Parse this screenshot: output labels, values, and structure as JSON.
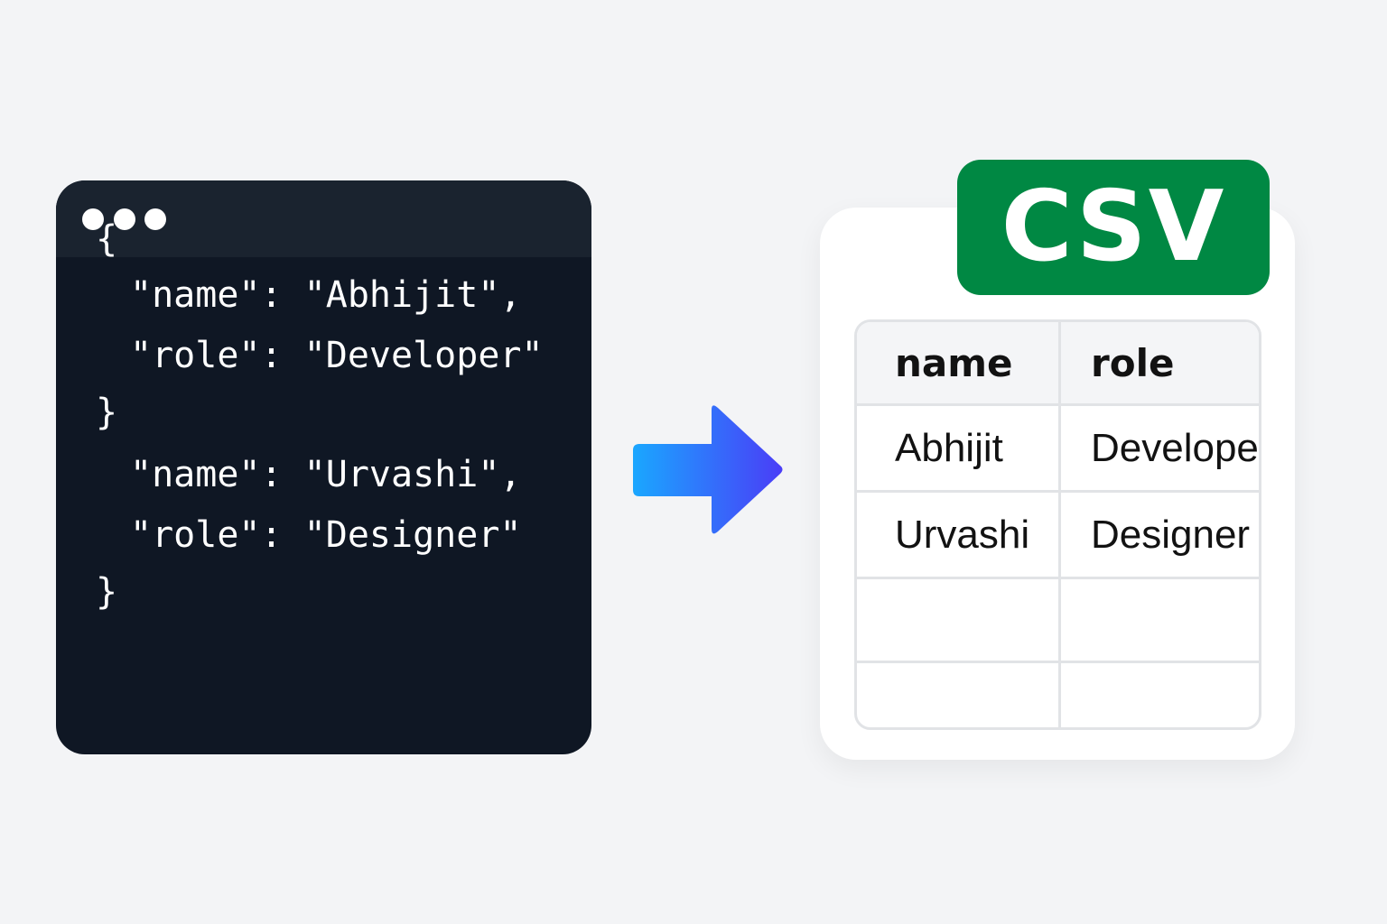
{
  "code_window": {
    "lines": [
      "{",
      "\"name\": \"Abhijit\",",
      "\"role\": \"Developer\"",
      "}",
      "\"name\": \"Urvashi\",",
      "\"role\": \"Designer\"",
      "}"
    ]
  },
  "arrow": {
    "icon": "arrow-right-icon",
    "gradient_start": "#1aa7ff",
    "gradient_end": "#4a3df7"
  },
  "csv": {
    "badge_label": "CSV",
    "badge_color": "#008843",
    "headers": [
      "name",
      "role"
    ],
    "rows": [
      [
        "Abhijit",
        "Developer"
      ],
      [
        "Urvashi",
        "Designer"
      ],
      [
        "",
        ""
      ],
      [
        "",
        ""
      ]
    ]
  }
}
